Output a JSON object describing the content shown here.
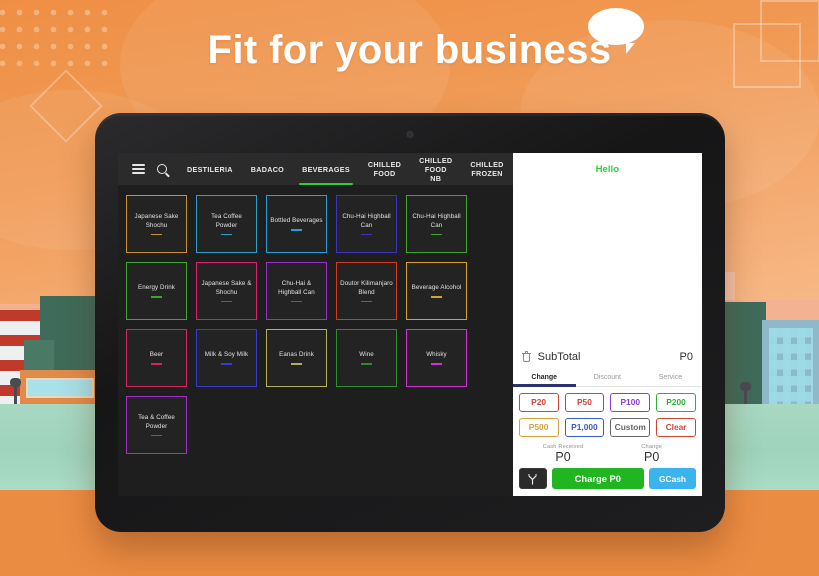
{
  "hero": {
    "headline": "Fit for your business",
    "bubble_icon": "speech-bubble-icon"
  },
  "pos": {
    "topbar": {
      "menu_icon": "hamburger-menu-icon",
      "search_icon": "search-icon",
      "tabs": [
        {
          "label": "DESTILERIA",
          "active": false
        },
        {
          "label": "BADACO",
          "active": false
        },
        {
          "label": "BEVERAGES",
          "active": true
        },
        {
          "label": "CHILLED\nFOOD",
          "active": false
        },
        {
          "label": "CHILLED\nFOOD NB",
          "active": false
        },
        {
          "label": "CHILLED\nFROZEN",
          "active": false
        }
      ],
      "active_underline_color": "#2ecc40"
    },
    "tiles": [
      {
        "name": "Japanese Sake Shochu",
        "color": "#c8922f"
      },
      {
        "name": "Tea  Coffee Powder",
        "color": "#2d9fc4"
      },
      {
        "name": "Bottled Beverages",
        "color": "#2b9fd4"
      },
      {
        "name": "Chu-Hai Highball Can",
        "color": "#3a35c0"
      },
      {
        "name": "Chu-Hai Highball Can",
        "color": "#3fa32f"
      },
      {
        "name": "Energy Drink",
        "color": "#3fa32f"
      },
      {
        "name": "Japanese Sake & Shochu",
        "color": "#d6226b"
      },
      {
        "name": "Chu-Hai & Highball Can",
        "color": "#9b2fc9"
      },
      {
        "name": "Doutor Kilimanjaro Blend",
        "color": "#d33a20"
      },
      {
        "name": "Beverage Alcohol",
        "color": "#d9a129"
      },
      {
        "name": "Beer",
        "color": "#d1265c"
      },
      {
        "name": "Milk & Soy Milk",
        "color": "#3a3ad0"
      },
      {
        "name": "Eanas Drink",
        "color": "#b5b05a"
      },
      {
        "name": "Wine",
        "color": "#2f8c2a"
      },
      {
        "name": "Whisky",
        "color": "#cf34cf"
      },
      {
        "name": "Tea & Coffee Powder",
        "color": "#a32fc9"
      }
    ],
    "checkout": {
      "greeting": "Hello",
      "greeting_color": "#2ecc40",
      "trash_icon": "trash-icon",
      "subtotal_label": "SubTotal",
      "subtotal_amount": "P0",
      "segments": [
        {
          "label": "Change",
          "active": true
        },
        {
          "label": "Discount",
          "active": false
        },
        {
          "label": "Service",
          "active": false
        }
      ],
      "denominations": [
        [
          {
            "label": "P20",
            "color": "#d0453a"
          },
          {
            "label": "P50",
            "color": "#d0453a"
          },
          {
            "label": "P100",
            "color": "#8a3fd0"
          },
          {
            "label": "P200",
            "color": "#2fae3a"
          }
        ],
        [
          {
            "label": "P500",
            "color": "#d1a33c"
          },
          {
            "label": "P1,000",
            "color": "#3a5ad0"
          },
          {
            "label": "Custom",
            "color": "#666666"
          },
          {
            "label": "Clear",
            "color": "#d0453a"
          }
        ]
      ],
      "cash_received_label": "Cash Received",
      "cash_received_value": "P0",
      "change_label": "Change",
      "change_value": "P0",
      "split_icon": "split-payment-icon",
      "charge_label": "Charge P0",
      "gcash_label": "GCash"
    }
  }
}
